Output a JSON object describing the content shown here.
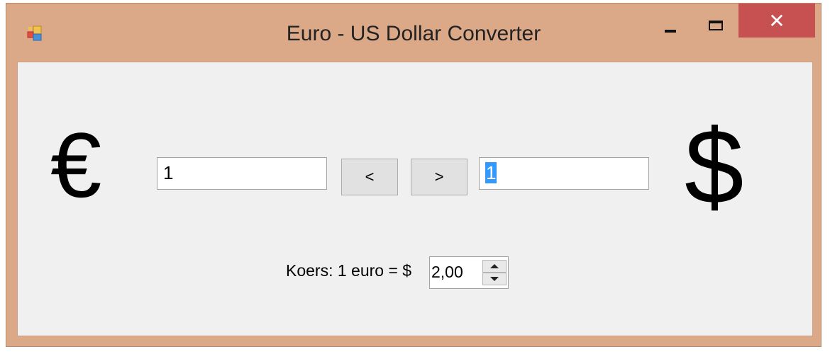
{
  "window": {
    "title": "Euro - US Dollar Converter",
    "icons": {
      "app": "app-icon",
      "minimize": "minimize-icon",
      "maximize": "maximize-icon",
      "close": "close-icon"
    },
    "close_glyph": "✕",
    "colors": {
      "frame": "#dba888",
      "close": "#c75050",
      "client": "#f0f0f0"
    }
  },
  "converter": {
    "euro_symbol": "€",
    "dollar_symbol": "$",
    "euro_value": "1",
    "dollar_value": "1",
    "to_euro_label": "<",
    "to_dollar_label": ">"
  },
  "rate": {
    "label": "Koers: 1 euro = $",
    "value": "2,00"
  }
}
